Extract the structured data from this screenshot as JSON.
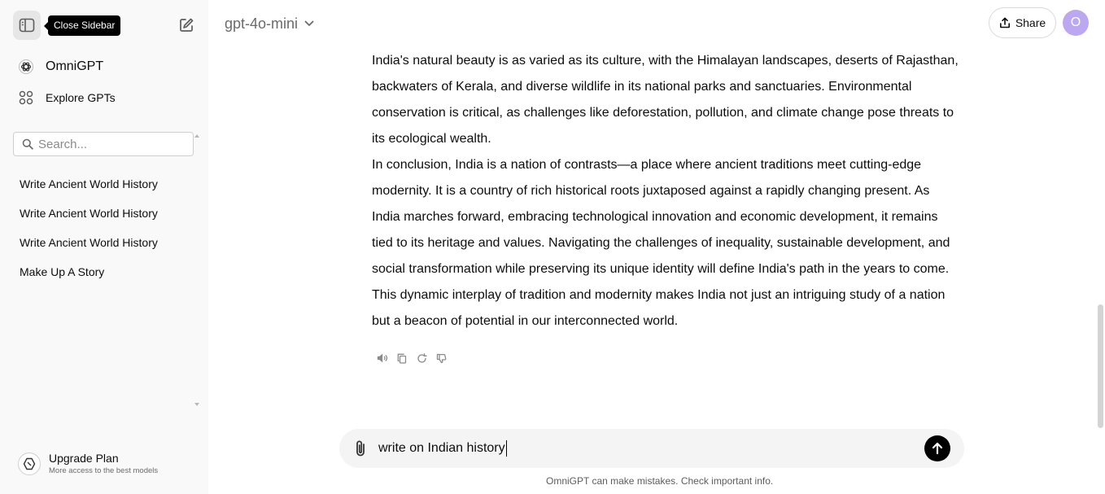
{
  "sidebar": {
    "tooltip": "Close Sidebar",
    "brand_label": "OmniGPT",
    "explore_label": "Explore GPTs",
    "search_placeholder": "Search...",
    "history": [
      {
        "label": "Write Ancient World History"
      },
      {
        "label": "Write Ancient World History"
      },
      {
        "label": "Write Ancient World History"
      },
      {
        "label": "Make Up A Story"
      }
    ],
    "upgrade_title": "Upgrade Plan",
    "upgrade_subtitle": "More access to the best models"
  },
  "header": {
    "model_name": "gpt-4o-mini",
    "share_label": "Share",
    "avatar_initial": "O"
  },
  "message": {
    "paragraphs": [
      "India's natural beauty is as varied as its culture, with the Himalayan landscapes, deserts of Rajasthan, backwaters of Kerala, and diverse wildlife in its national parks and sanctuaries. Environmental conservation is critical, as challenges like deforestation, pollution, and climate change pose threats to its ecological wealth.",
      "In conclusion, India is a nation of contrasts—a place where ancient traditions meet cutting-edge modernity. It is a country of rich historical roots juxtaposed against a rapidly changing present. As India marches forward, embracing technological innovation and economic development, it remains tied to its heritage and values. Navigating the challenges of inequality, sustainable development, and social transformation while preserving its unique identity will define India's path in the years to come. This dynamic interplay of tradition and modernity makes India not just an intriguing study of a nation but a beacon of potential in our interconnected world."
    ],
    "action_icons": [
      "speaker-icon",
      "copy-icon",
      "regenerate-icon",
      "thumbs-down-icon"
    ]
  },
  "composer": {
    "input_value": "write on Indian history",
    "disclaimer": "OmniGPT can make mistakes. Check important info."
  },
  "colors": {
    "sidebar_bg": "#f9f9f9",
    "avatar_bg": "#bba8f0",
    "composer_bg": "#f4f4f4",
    "send_button": "#000000"
  }
}
